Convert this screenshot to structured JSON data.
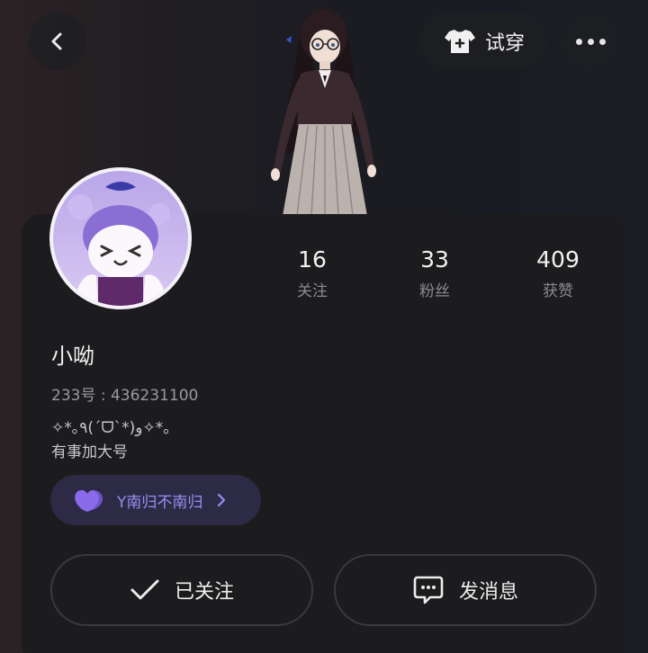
{
  "topbar": {
    "tryon_label": "试穿"
  },
  "stats": [
    {
      "value": "16",
      "label": "关注"
    },
    {
      "value": "33",
      "label": "粉丝"
    },
    {
      "value": "409",
      "label": "获赞"
    }
  ],
  "profile": {
    "username": "小呦",
    "uid": "233号 : 436231100",
    "bio_line1": "✧*｡٩(ˊᗜˋ*)و✧*｡",
    "bio_line2": "有事加大号",
    "tag_label": "Y南归不南归"
  },
  "actions": {
    "follow_label": "已关注",
    "message_label": "发消息"
  },
  "colors": {
    "card_bg": "#1c1c1f",
    "tag_bg": "#2c2a45",
    "tag_text": "#9b8ef0",
    "heart": "#8a6ae8"
  },
  "icons": [
    "back-arrow-icon",
    "tshirt-icon",
    "more-dots-icon",
    "heart-icon",
    "chevron-right-icon",
    "check-icon",
    "chat-bubble-icon"
  ]
}
